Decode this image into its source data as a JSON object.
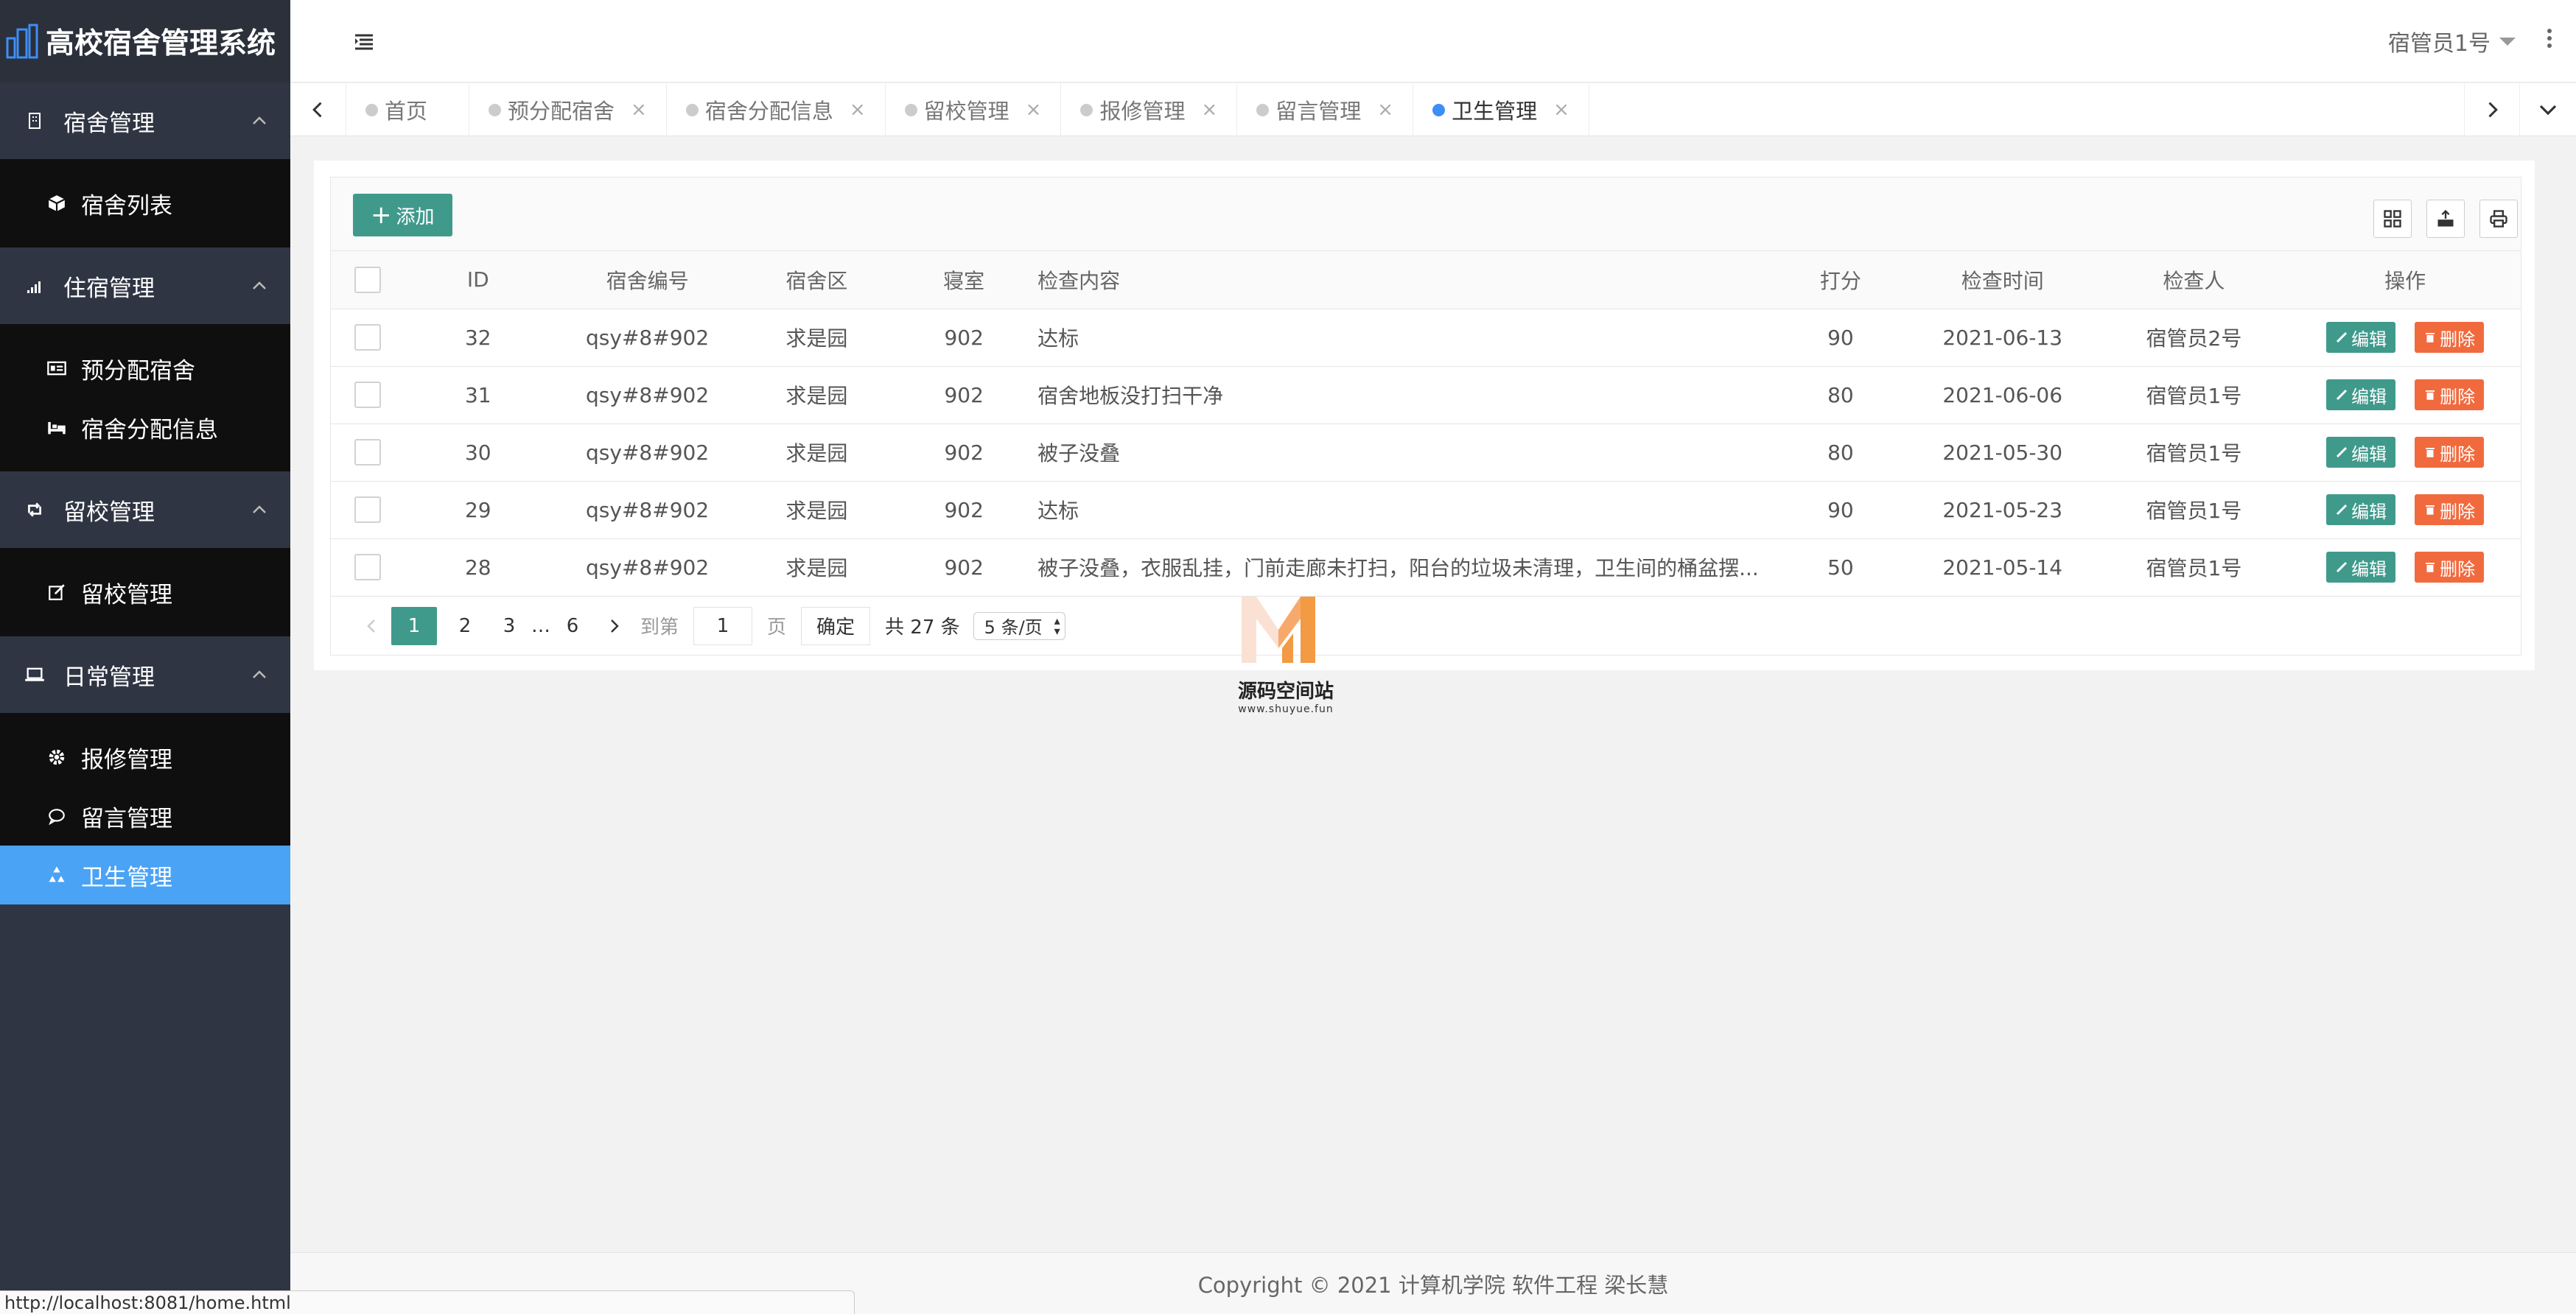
{
  "app": {
    "title": "高校宿舍管理系统"
  },
  "sidebar": {
    "groups": [
      {
        "label": "宿舍管理",
        "icon": "building-icon",
        "items": [
          {
            "label": "宿舍列表",
            "icon": "cube-icon"
          }
        ]
      },
      {
        "label": "住宿管理",
        "icon": "signal-icon",
        "items": [
          {
            "label": "预分配宿舍",
            "icon": "id-card-icon"
          },
          {
            "label": "宿舍分配信息",
            "icon": "bed-icon"
          }
        ]
      },
      {
        "label": "留校管理",
        "icon": "retweet-icon",
        "items": [
          {
            "label": "留校管理",
            "icon": "edit-icon"
          }
        ]
      },
      {
        "label": "日常管理",
        "icon": "laptop-icon",
        "items": [
          {
            "label": "报修管理",
            "icon": "gear-icon"
          },
          {
            "label": "留言管理",
            "icon": "comment-icon"
          },
          {
            "label": "卫生管理",
            "icon": "recycle-icon",
            "active": true
          }
        ]
      }
    ]
  },
  "header": {
    "user": "宿管员1号"
  },
  "tabs": [
    {
      "label": "首页"
    },
    {
      "label": "预分配宿舍",
      "close": "×"
    },
    {
      "label": "宿舍分配信息",
      "close": "×"
    },
    {
      "label": "留校管理",
      "close": "×"
    },
    {
      "label": "报修管理",
      "close": "×"
    },
    {
      "label": "留言管理",
      "close": "×"
    },
    {
      "label": "卫生管理",
      "close": "×",
      "active": true
    }
  ],
  "toolbar": {
    "add_label": "添加"
  },
  "table": {
    "columns": [
      "ID",
      "宿舍编号",
      "宿舍区",
      "寝室",
      "检查内容",
      "打分",
      "检查时间",
      "检查人",
      "操作"
    ],
    "rows": [
      {
        "id": "32",
        "dorm_no": "qsy#8#902",
        "area": "求是园",
        "room": "902",
        "content": "达标",
        "score": "90",
        "time": "2021-06-13",
        "inspector": "宿管员2号"
      },
      {
        "id": "31",
        "dorm_no": "qsy#8#902",
        "area": "求是园",
        "room": "902",
        "content": "宿舍地板没打扫干净",
        "score": "80",
        "time": "2021-06-06",
        "inspector": "宿管员1号"
      },
      {
        "id": "30",
        "dorm_no": "qsy#8#902",
        "area": "求是园",
        "room": "902",
        "content": "被子没叠",
        "score": "80",
        "time": "2021-05-30",
        "inspector": "宿管员1号"
      },
      {
        "id": "29",
        "dorm_no": "qsy#8#902",
        "area": "求是园",
        "room": "902",
        "content": "达标",
        "score": "90",
        "time": "2021-05-23",
        "inspector": "宿管员1号"
      },
      {
        "id": "28",
        "dorm_no": "qsy#8#902",
        "area": "求是园",
        "room": "902",
        "content": "被子没叠，衣服乱挂，门前走廊未打扫，阳台的垃圾未清理，卫生间的桶盆摆...",
        "score": "50",
        "time": "2021-05-14",
        "inspector": "宿管员1号"
      }
    ],
    "edit_label": "编辑",
    "delete_label": "删除"
  },
  "pager": {
    "current": "1",
    "pages": [
      "2",
      "3"
    ],
    "ellipsis": "…",
    "last": "6",
    "goto_prefix": "到第",
    "goto_value": "1",
    "goto_suffix": "页",
    "confirm": "确定",
    "total": "共 27 条",
    "page_size": "5 条/页"
  },
  "watermark": {
    "title": "源码空间站",
    "url": "www.shuyue.fun"
  },
  "footer": {
    "text": "Copyright © 2021 计算机学院 软件工程 梁长慧"
  },
  "statusbar": {
    "url": "http://localhost:8081/home.html"
  },
  "colors": {
    "sidebar_bg": "#2f3543",
    "active_item": "#4aa3f5",
    "primary": "#409a8c",
    "danger": "#f16a3e"
  }
}
